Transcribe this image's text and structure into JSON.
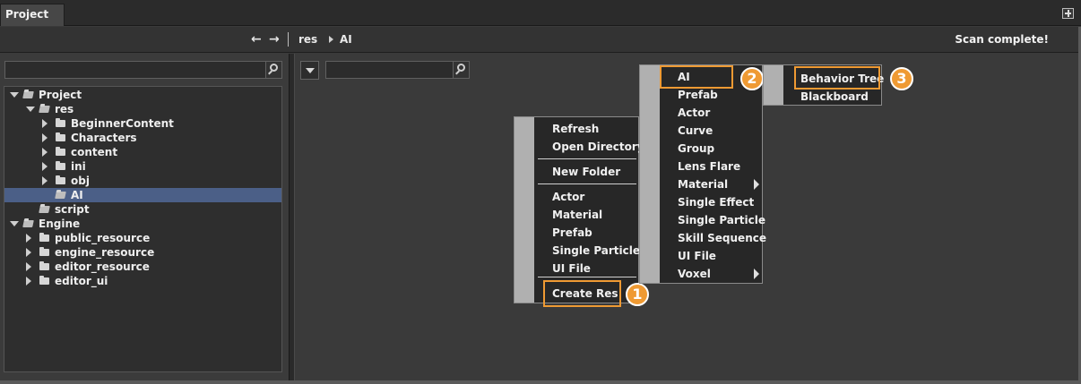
{
  "tab": {
    "title": "Project"
  },
  "toolbar": {
    "back_glyph": "←",
    "forward_glyph": "→",
    "breadcrumb": [
      "res",
      "AI"
    ],
    "status": "Scan complete!"
  },
  "tree": [
    {
      "label": "Project",
      "depth": 0,
      "expander": "open",
      "icon": "folder-open"
    },
    {
      "label": "res",
      "depth": 1,
      "expander": "open",
      "icon": "folder-open"
    },
    {
      "label": "BeginnerContent",
      "depth": 2,
      "expander": "closed",
      "icon": "folder"
    },
    {
      "label": "Characters",
      "depth": 2,
      "expander": "closed",
      "icon": "folder"
    },
    {
      "label": "content",
      "depth": 2,
      "expander": "closed",
      "icon": "folder"
    },
    {
      "label": "ini",
      "depth": 2,
      "expander": "closed",
      "icon": "folder"
    },
    {
      "label": "obj",
      "depth": 2,
      "expander": "closed",
      "icon": "folder"
    },
    {
      "label": "AI",
      "depth": 2,
      "expander": "none",
      "icon": "folder-open",
      "selected": true
    },
    {
      "label": "script",
      "depth": 1,
      "expander": "none",
      "icon": "folder-open"
    },
    {
      "label": "Engine",
      "depth": 0,
      "expander": "open",
      "icon": "folder-open"
    },
    {
      "label": "public_resource",
      "depth": 1,
      "expander": "closed",
      "icon": "folder"
    },
    {
      "label": "engine_resource",
      "depth": 1,
      "expander": "closed",
      "icon": "folder"
    },
    {
      "label": "editor_resource",
      "depth": 1,
      "expander": "closed",
      "icon": "folder"
    },
    {
      "label": "editor_ui",
      "depth": 1,
      "expander": "closed",
      "icon": "folder"
    }
  ],
  "context_menu": {
    "items": [
      {
        "label": "Refresh"
      },
      {
        "label": "Open Directory"
      },
      {
        "label": "New Folder"
      },
      {
        "label": "Actor"
      },
      {
        "label": "Material"
      },
      {
        "label": "Prefab"
      },
      {
        "label": "Single Particle"
      },
      {
        "label": "UI File"
      },
      {
        "label": "Create Res",
        "highlighted": true,
        "badge": "1"
      }
    ]
  },
  "create_res_menu": {
    "items": [
      {
        "label": "AI",
        "highlighted": true,
        "badge": "2",
        "has_submenu": false
      },
      {
        "label": "Prefab"
      },
      {
        "label": "Actor"
      },
      {
        "label": "Curve"
      },
      {
        "label": "Group"
      },
      {
        "label": "Lens Flare"
      },
      {
        "label": "Material",
        "has_submenu": true
      },
      {
        "label": "Single Effect"
      },
      {
        "label": "Single Particle"
      },
      {
        "label": "Skill Sequence"
      },
      {
        "label": "UI File"
      },
      {
        "label": "Voxel",
        "has_submenu": true
      }
    ]
  },
  "ai_menu": {
    "items": [
      {
        "label": "Behavior Tree",
        "highlighted": true,
        "badge": "3"
      },
      {
        "label": "Blackboard"
      }
    ]
  },
  "colors": {
    "accent": "#ef9a33",
    "selection": "#4b5f87"
  }
}
